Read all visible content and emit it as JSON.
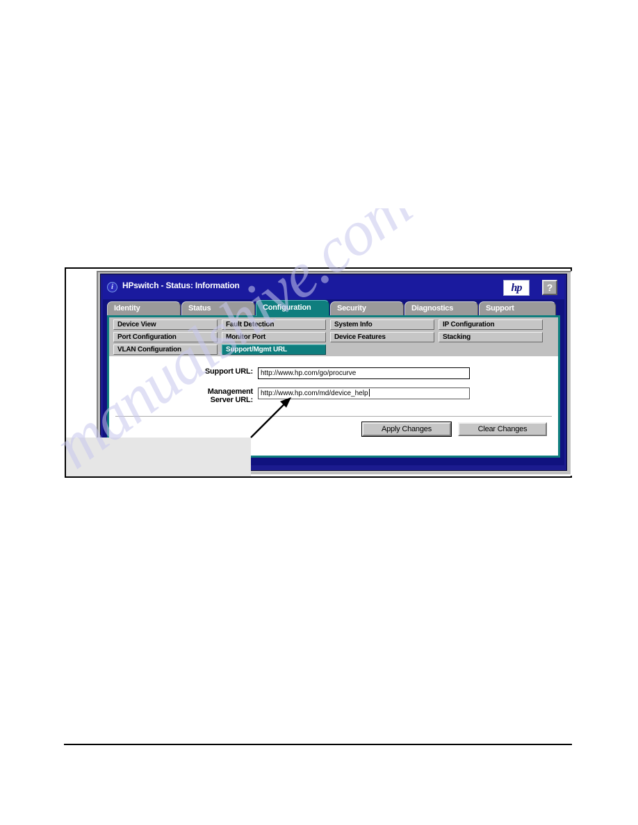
{
  "window": {
    "title": "HPswitch - Status: Information",
    "info_icon": "info-circle-icon",
    "brand_logo": "hp",
    "help_label": "?"
  },
  "tabs": [
    {
      "label": "Identity",
      "active": false
    },
    {
      "label": "Status",
      "active": false
    },
    {
      "label": "Configuration",
      "active": true
    },
    {
      "label": "Security",
      "active": false
    },
    {
      "label": "Diagnostics",
      "active": false
    },
    {
      "label": "Support",
      "active": false
    }
  ],
  "subnav": {
    "rows": [
      [
        {
          "label": "Device View",
          "selected": false
        },
        {
          "label": "Fault Detection",
          "selected": false
        },
        {
          "label": "System Info",
          "selected": false
        },
        {
          "label": "IP Configuration",
          "selected": false
        }
      ],
      [
        {
          "label": "Port Configuration",
          "selected": false
        },
        {
          "label": "Monitor Port",
          "selected": false
        },
        {
          "label": "Device Features",
          "selected": false
        },
        {
          "label": "Stacking",
          "selected": false
        }
      ],
      [
        {
          "label": "VLAN Configuration",
          "selected": false
        },
        {
          "label": "Support/Mgmt URL",
          "selected": true
        },
        {
          "label": "",
          "selected": false
        },
        {
          "label": "",
          "selected": false
        }
      ]
    ]
  },
  "form": {
    "support_url": {
      "label": "Support URL:",
      "value": "http://www.hp.com/go/procurve",
      "placeholder": "http://"
    },
    "management_server_url": {
      "label_line1": "Management",
      "label_line2": "Server URL:",
      "value": "http://www.hp.com/md/device_help",
      "placeholder": "http://",
      "focused": true
    }
  },
  "buttons": {
    "apply": "Apply Changes",
    "clear": "Clear Changes"
  },
  "watermark": {
    "text": "manualshive.com"
  },
  "colors": {
    "titlebar_blue": "#1a1a9e",
    "window_blue": "#10127f",
    "accent_teal": "#0f7e7e",
    "tab_gray": "#9a9a9a",
    "button_face": "#c6c6c6"
  }
}
